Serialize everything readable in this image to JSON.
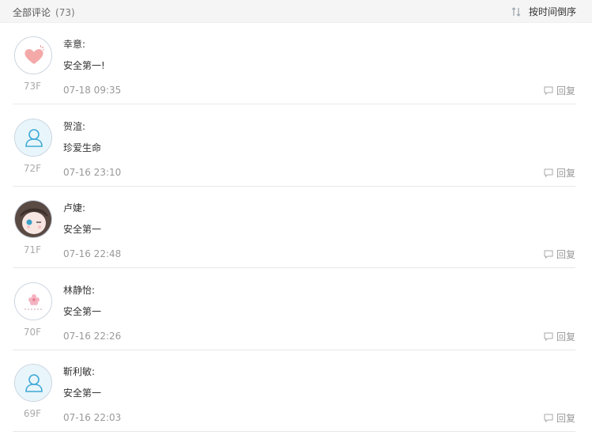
{
  "header": {
    "title": "全部评论",
    "count": "(73)",
    "sort_label": "按时间倒序",
    "sort_icon": "sort-arrows-icon"
  },
  "reply_label": "回复",
  "comments": [
    {
      "name": "幸意:",
      "text": "安全第一!",
      "floor": "73F",
      "time": "07-18 09:35",
      "avatar": "heart-avatar"
    },
    {
      "name": "贺渲:",
      "text": "珍爱生命",
      "floor": "72F",
      "time": "07-16 23:10",
      "avatar": "default-user-avatar"
    },
    {
      "name": "卢婕:",
      "text": "安全第一",
      "floor": "71F",
      "time": "07-16 22:48",
      "avatar": "anime-girl-avatar"
    },
    {
      "name": "林静怡:",
      "text": "安全第一",
      "floor": "70F",
      "time": "07-16 22:26",
      "avatar": "flower-avatar"
    },
    {
      "name": "靳利敏:",
      "text": "安全第一",
      "floor": "69F",
      "time": "07-16 22:03",
      "avatar": "default-user-avatar"
    }
  ],
  "colors": {
    "header_bg": "#f5f5f5",
    "user_icon": "#3fa9d6",
    "heart": "#f29a9a",
    "meta_text": "#999999"
  }
}
